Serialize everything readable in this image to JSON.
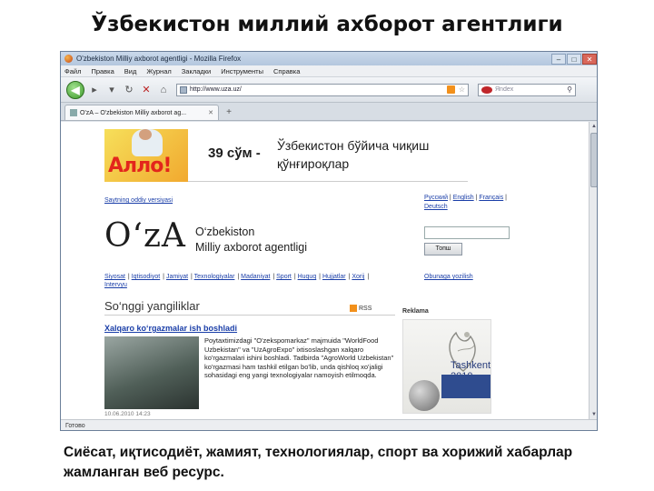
{
  "slide": {
    "title": "Ўзбекистон миллий ахборот агентлиги",
    "caption_line1": "Сиёсат, иқтисодиёт, жамият, технологиялар, спорт ва хорижий хабарлар",
    "caption_line2": "жамланган веб ресурс."
  },
  "browser": {
    "window_title": "O'zbekiston Milliy axborot agentligi - Mozilla Firefox",
    "menu": [
      "Файл",
      "Правка",
      "Вид",
      "Журнал",
      "Закладки",
      "Инструменты",
      "Справка"
    ],
    "url": "http://www.uza.uz/",
    "search_placeholder": "Яndex",
    "tab_label": "O'zA – O'zbekiston Milliy axborot ag...",
    "status": "Готово"
  },
  "page": {
    "banner_price": "39 сўм -",
    "banner_line1": "Ўзбекистон бўйича чиқиш",
    "banner_line2": "қўнғироқлар",
    "banner_logo": "Алло!",
    "blind_version": "Saytning oddiy versiyasi",
    "languages": [
      "Русский",
      "English",
      "Français",
      "Deutsch"
    ],
    "logo": "O‘zA",
    "agency_line1": "O‘zbekiston",
    "agency_line2": "Milliy axborot agentligi",
    "search_button": "Топш",
    "sections": [
      "Siyosat",
      "Iqtisodiyot",
      "Jamiyat",
      "Texnologiyalar",
      "Madaniyat",
      "Sport",
      "Huquq",
      "Hujjatlar",
      "Xorij",
      "Intervyu"
    ],
    "subscribe": "Obunaga yozilish",
    "news_heading": "So‘nggi yangiliklar",
    "rss_label": "RSS",
    "ad_heading": "Reklama",
    "article_title": "Xalqaro ko‘rgazmalar ish boshladi",
    "article_text": "Poytaxtimizdagi \"O'zekspomarkaz\" majmuida \"WorldFood Uzbekistan\" va \"UzAgroExpo\" ixtisoslashgan xalqaro ko'rgazmalari ishini boshladi. Tadbirda \"AgroWorld Uzbekistan\" ko'rgazmasi ham tashkil etilgan bo'lib, unda qishloq xo'jaligi sohasidagi eng yangi texnologiyalar namoyish etilmoqda.",
    "article_date": "10.06.2010 14:23",
    "ad_name": "Tashkent 2010"
  }
}
